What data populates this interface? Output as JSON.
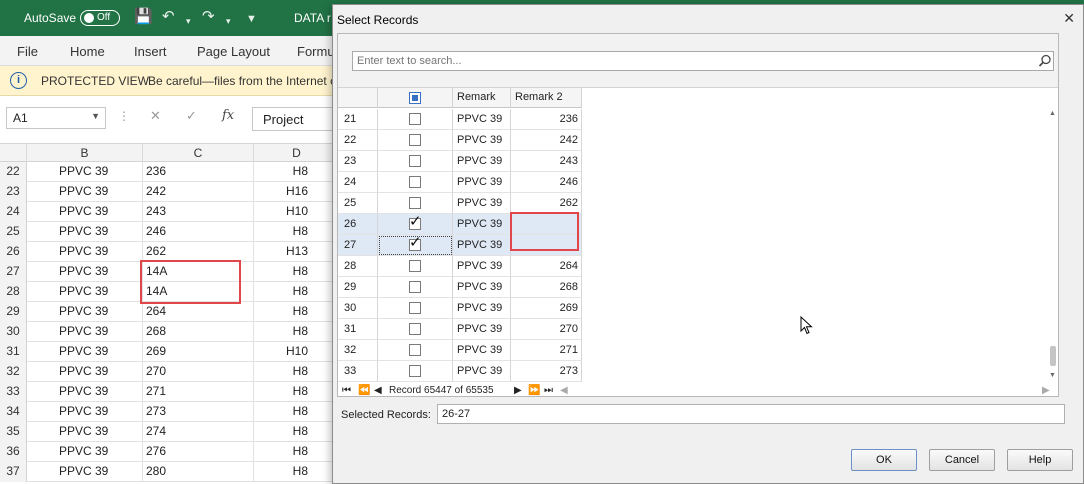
{
  "excel": {
    "autosave_label": "AutoSave",
    "autosave_state": "Off",
    "doc_title": "DATA r",
    "ribbon_tabs": [
      "File",
      "Home",
      "Insert",
      "Page Layout",
      "Formu"
    ],
    "protected_view": {
      "title": "PROTECTED VIEW",
      "message": "Be careful—files from the Internet c"
    },
    "name_box": "A1",
    "formula_value": "Project",
    "columns": [
      "B",
      "C",
      "D"
    ],
    "rows": [
      {
        "row": "22",
        "b": "PPVC 39",
        "c": "236",
        "d": "H8"
      },
      {
        "row": "23",
        "b": "PPVC 39",
        "c": "242",
        "d": "H16"
      },
      {
        "row": "24",
        "b": "PPVC 39",
        "c": "243",
        "d": "H10"
      },
      {
        "row": "25",
        "b": "PPVC 39",
        "c": "246",
        "d": "H8"
      },
      {
        "row": "26",
        "b": "PPVC 39",
        "c": "262",
        "d": "H13"
      },
      {
        "row": "27",
        "b": "PPVC 39",
        "c": "14A",
        "d": "H8"
      },
      {
        "row": "28",
        "b": "PPVC 39",
        "c": "14A",
        "d": "H8"
      },
      {
        "row": "29",
        "b": "PPVC 39",
        "c": "264",
        "d": "H8"
      },
      {
        "row": "30",
        "b": "PPVC 39",
        "c": "268",
        "d": "H8"
      },
      {
        "row": "31",
        "b": "PPVC 39",
        "c": "269",
        "d": "H10"
      },
      {
        "row": "32",
        "b": "PPVC 39",
        "c": "270",
        "d": "H8"
      },
      {
        "row": "33",
        "b": "PPVC 39",
        "c": "271",
        "d": "H8"
      },
      {
        "row": "34",
        "b": "PPVC 39",
        "c": "273",
        "d": "H8"
      },
      {
        "row": "35",
        "b": "PPVC 39",
        "c": "274",
        "d": "H8"
      },
      {
        "row": "36",
        "b": "PPVC 39",
        "c": "276",
        "d": "H8"
      },
      {
        "row": "37",
        "b": "PPVC 39",
        "c": "280",
        "d": "H8"
      }
    ]
  },
  "dialog": {
    "title": "Select Records",
    "search_placeholder": "Enter text to search...",
    "columns": [
      "Remark",
      "Remark 2"
    ],
    "rows": [
      {
        "num": "21",
        "checked": false,
        "remark": "PPVC 39",
        "remark2": "236"
      },
      {
        "num": "22",
        "checked": false,
        "remark": "PPVC 39",
        "remark2": "242"
      },
      {
        "num": "23",
        "checked": false,
        "remark": "PPVC 39",
        "remark2": "243"
      },
      {
        "num": "24",
        "checked": false,
        "remark": "PPVC 39",
        "remark2": "246"
      },
      {
        "num": "25",
        "checked": false,
        "remark": "PPVC 39",
        "remark2": "262"
      },
      {
        "num": "26",
        "checked": true,
        "remark": "PPVC 39",
        "remark2": ""
      },
      {
        "num": "27",
        "checked": true,
        "remark": "PPVC 39",
        "remark2": ""
      },
      {
        "num": "28",
        "checked": false,
        "remark": "PPVC 39",
        "remark2": "264"
      },
      {
        "num": "29",
        "checked": false,
        "remark": "PPVC 39",
        "remark2": "268"
      },
      {
        "num": "30",
        "checked": false,
        "remark": "PPVC 39",
        "remark2": "269"
      },
      {
        "num": "31",
        "checked": false,
        "remark": "PPVC 39",
        "remark2": "270"
      },
      {
        "num": "32",
        "checked": false,
        "remark": "PPVC 39",
        "remark2": "271"
      },
      {
        "num": "33",
        "checked": false,
        "remark": "PPVC 39",
        "remark2": "273"
      }
    ],
    "record_nav": "Record 65447 of 65535",
    "selected_records_label": "Selected Records:",
    "selected_records_value": "26-27",
    "buttons": {
      "ok": "OK",
      "cancel": "Cancel",
      "help": "Help"
    }
  },
  "colors": {
    "excel_green": "#217346",
    "protected_yellow": "#fff4ce",
    "highlight_red": "#e0464a",
    "selection_blue": "#dfe8f5"
  }
}
